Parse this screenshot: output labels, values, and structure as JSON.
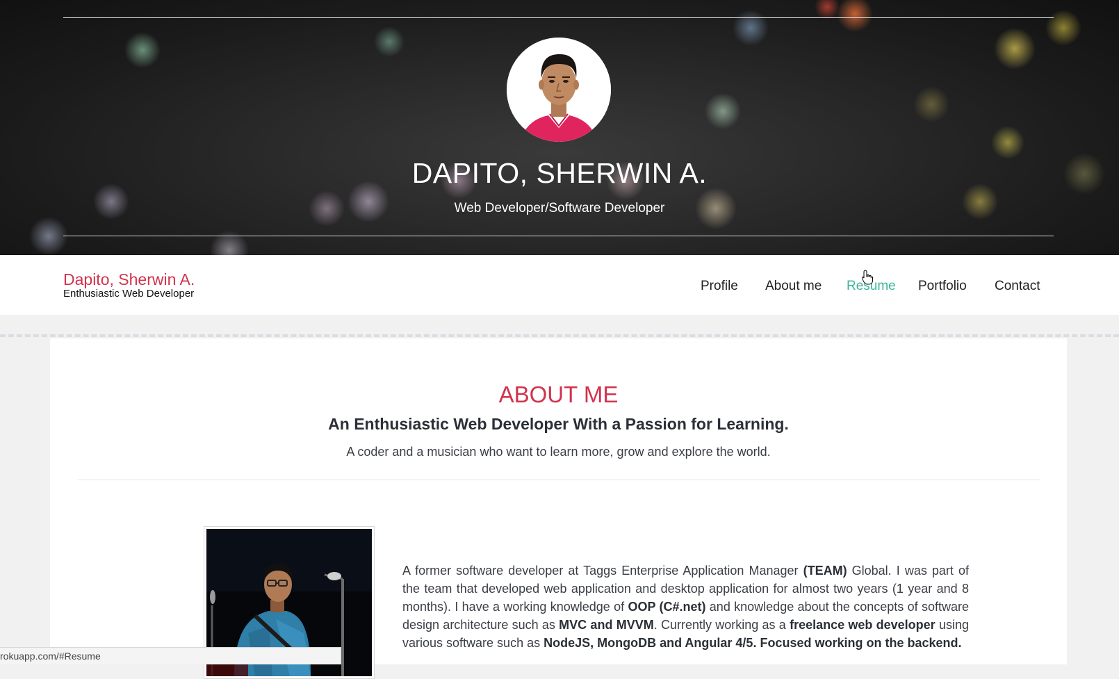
{
  "hero": {
    "name": "DAPITO, SHERWIN A.",
    "subtitle": "Web Developer/Software Developer"
  },
  "navbar": {
    "brand_name": "Dapito, Sherwin A.",
    "brand_tagline": "Enthusiastic Web Developer",
    "items": [
      {
        "label": "Profile",
        "active": false
      },
      {
        "label": "About me",
        "active": false
      },
      {
        "label": "Resume",
        "active": true
      },
      {
        "label": "Portfolio",
        "active": false
      },
      {
        "label": "Contact",
        "active": false
      }
    ]
  },
  "about": {
    "title": "ABOUT ME",
    "subtitle": "An Enthusiastic Web Developer With a Passion for Learning.",
    "description": "A coder and a musician who want to learn more, grow and explore the world.",
    "bio": {
      "p1": "A former software developer at Taggs Enterprise Application Manager ",
      "b1": "(TEAM)",
      "p2": " Global. I was part of the team that developed web application and desktop application for almost two years (1 year and 8 months). I have a working knowledge of ",
      "b2": "OOP (C#.net)",
      "p3": " and knowledge about the concepts of software design architecture such as ",
      "b3": "MVC and MVVM",
      "p4": ". Currently working as a ",
      "b4": "freelance web developer",
      "p5": " using various software such as ",
      "b5": "NodeJS, MongoDB and Angular 4/5. Focused working on the backend."
    }
  },
  "status_bar": {
    "url": "rokuapp.com/#Resume"
  },
  "colors": {
    "accent_red": "#d2334d",
    "accent_teal": "#3db59e",
    "hero_bg": "#1b1b1b"
  }
}
